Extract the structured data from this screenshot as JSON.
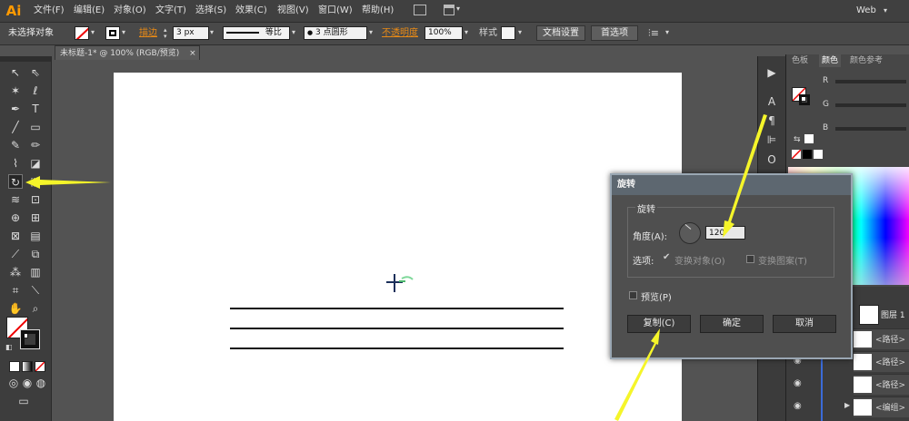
{
  "app": {
    "logo": "Ai",
    "workspace": "Web"
  },
  "menu": [
    "文件(F)",
    "编辑(E)",
    "对象(O)",
    "文字(T)",
    "选择(S)",
    "效果(C)",
    "视图(V)",
    "窗口(W)",
    "帮助(H)"
  ],
  "control": {
    "selection_status": "未选择对象",
    "stroke_label": "描边",
    "stroke_value": "3 px",
    "profile": "等比",
    "brush": "3 点圆形",
    "opacity_label": "不透明度",
    "opacity_value": "100%",
    "style_label": "样式",
    "doc_setup": "文档设置",
    "preferences": "首选项"
  },
  "document": {
    "tab": "未标题-1* @ 100% (RGB/预览)",
    "close": "×"
  },
  "right_panel": {
    "tabs": [
      "色板",
      "颜色",
      "颜色参考"
    ],
    "channels": [
      "R",
      "G",
      "B"
    ],
    "layer_name": "图层 1",
    "layer_rows": [
      "<路径>",
      "<路径>",
      "<路径>",
      "<编组>"
    ]
  },
  "dialog": {
    "title": "旋转",
    "group_title": "旋转",
    "angle_label": "角度(A):",
    "angle_value": "120°",
    "options_label": "选项:",
    "transform_objects": "变换对象(O)",
    "transform_patterns": "变换图案(T)",
    "preview": "预览(P)",
    "copy": "复制(C)",
    "ok": "确定",
    "cancel": "取消"
  },
  "colors": {
    "accent_orange": "#ff9a00",
    "annotation_arrow": "#f5f52a",
    "dialog_border": "#9aa7b3"
  }
}
